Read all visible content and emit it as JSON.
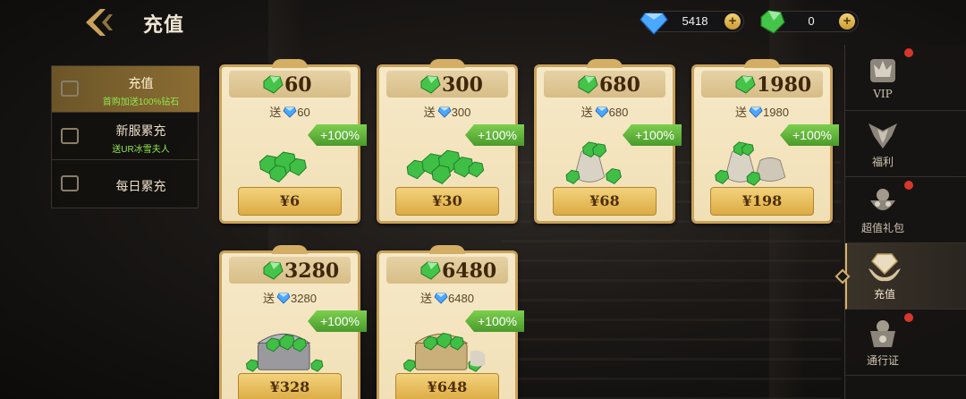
{
  "header": {
    "title": "充值",
    "blue_gem_amount": "5418",
    "green_gem_amount": "0",
    "plus_label": "+"
  },
  "left_menu": [
    {
      "label": "充值",
      "sub": "首购加送100%钻石",
      "active": true
    },
    {
      "label": "新服累充",
      "sub": "送UR冰雪夫人",
      "active": false
    },
    {
      "label": "每日累充",
      "sub": "",
      "active": false
    }
  ],
  "packages": [
    {
      "gems": "60",
      "bonus_prefix": "送",
      "bonus": "60",
      "badge": "+100%",
      "price": "¥6",
      "art": "pile-small"
    },
    {
      "gems": "300",
      "bonus_prefix": "送",
      "bonus": "300",
      "badge": "+100%",
      "price": "¥30",
      "art": "pile-large"
    },
    {
      "gems": "680",
      "bonus_prefix": "送",
      "bonus": "680",
      "badge": "+100%",
      "price": "¥68",
      "art": "sack"
    },
    {
      "gems": "1980",
      "bonus_prefix": "送",
      "bonus": "1980",
      "badge": "+100%",
      "price": "¥198",
      "art": "sacks"
    },
    {
      "gems": "3280",
      "bonus_prefix": "送",
      "bonus": "3280",
      "badge": "+100%",
      "price": "¥328",
      "art": "chest-silver"
    },
    {
      "gems": "6480",
      "bonus_prefix": "送",
      "bonus": "6480",
      "badge": "+100%",
      "price": "¥648",
      "art": "chest-gold"
    }
  ],
  "right_nav": [
    {
      "label": "VIP",
      "icon": "vip-crown-icon",
      "dot": true,
      "active": false
    },
    {
      "label": "福利",
      "icon": "welfare-emblem-icon",
      "dot": false,
      "active": false
    },
    {
      "label": "超值礼包",
      "icon": "gift-pack-icon",
      "dot": true,
      "active": false
    },
    {
      "label": "充值",
      "icon": "recharge-hand-gem-icon",
      "dot": false,
      "active": true
    },
    {
      "label": "通行证",
      "icon": "pass-icon",
      "dot": true,
      "active": false
    }
  ],
  "colors": {
    "card_bg": "#f3e4bd",
    "card_border": "#c9a25a",
    "badge_green": "#5fb63a",
    "price_gold": "#e6b955",
    "active_menu": "#7a6130",
    "red_dot": "#d7362b"
  }
}
